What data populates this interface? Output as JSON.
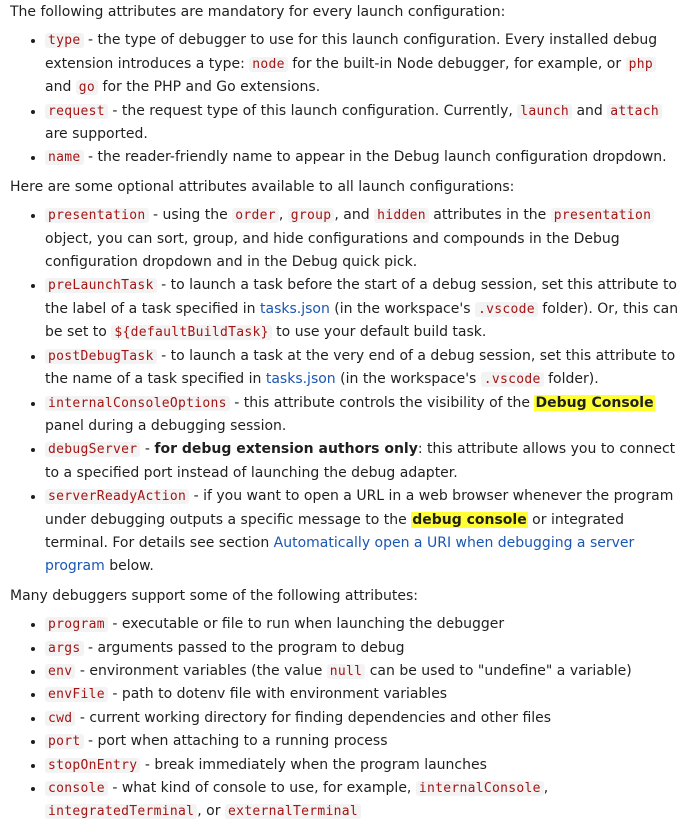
{
  "intro_mandatory": "The following attributes are mandatory for every launch configuration:",
  "mandatory": {
    "type": {
      "code": "type",
      "t1": " - the type of debugger to use for this launch configuration. Every installed debug extension introduces a type: ",
      "c1": "node",
      "t2": " for the built-in Node debugger, for example, or ",
      "c2": "php",
      "t3": " and ",
      "c3": "go",
      "t4": " for the PHP and Go extensions."
    },
    "request": {
      "code": "request",
      "t1": " - the request type of this launch configuration. Currently, ",
      "c1": "launch",
      "t2": " and ",
      "c2": "attach",
      "t3": " are supported."
    },
    "name": {
      "code": "name",
      "t1": " - the reader-friendly name to appear in the Debug launch configuration dropdown."
    }
  },
  "intro_optional": "Here are some optional attributes available to all launch configurations:",
  "optional": {
    "presentation": {
      "code": "presentation",
      "t1": " - using the ",
      "c1": "order",
      "t2": ", ",
      "c2": "group",
      "t3": ", and ",
      "c3": "hidden",
      "t4": " attributes in the ",
      "c4": "presentation",
      "t5": " object, you can sort, group, and hide configurations and compounds in the Debug configuration dropdown and in the Debug quick pick."
    },
    "preLaunchTask": {
      "code": "preLaunchTask",
      "t1": " - to launch a task before the start of a debug session, set this attribute to the label of a task specified in ",
      "link": "tasks.json",
      "t2": " (in the workspace's ",
      "c1": ".vscode",
      "t3": " folder). Or, this can be set to ",
      "c2": "${defaultBuildTask}",
      "t4": " to use your default build task."
    },
    "postDebugTask": {
      "code": "postDebugTask",
      "t1": " - to launch a task at the very end of a debug session, set this attribute to the name of a task specified in ",
      "link": "tasks.json",
      "t2": " (in the workspace's ",
      "c1": ".vscode",
      "t3": " folder)."
    },
    "internalConsoleOptions": {
      "code": "internalConsoleOptions",
      "t1": " - this attribute controls the visibility of the ",
      "mark": "Debug Console",
      "t2": " panel during a debugging session."
    },
    "debugServer": {
      "code": "debugServer",
      "t1": " - ",
      "bold": "for debug extension authors only",
      "t2": ": this attribute allows you to connect to a specified port instead of launching the debug adapter."
    },
    "serverReadyAction": {
      "code": "serverReadyAction",
      "t1": " - if you want to open a URL in a web browser whenever the program under debugging outputs a specific message to the ",
      "mark": "debug console",
      "t2": " or integrated terminal. For details see section ",
      "link": "Automatically open a URI when debugging a server program",
      "t3": " below."
    }
  },
  "intro_many": "Many debuggers support some of the following attributes:",
  "many": {
    "program": {
      "code": "program",
      "t1": " - executable or file to run when launching the debugger"
    },
    "args": {
      "code": "args",
      "t1": " - arguments passed to the program to debug"
    },
    "env": {
      "code": "env",
      "t1": " - environment variables (the value ",
      "c1": "null",
      "t2": " can be used to \"undefine\" a variable)"
    },
    "envFile": {
      "code": "envFile",
      "t1": " - path to dotenv file with environment variables"
    },
    "cwd": {
      "code": "cwd",
      "t1": " - current working directory for finding dependencies and other files"
    },
    "port": {
      "code": "port",
      "t1": " - port when attaching to a running process"
    },
    "stopOnEntry": {
      "code": "stopOnEntry",
      "t1": " - break immediately when the program launches"
    },
    "console": {
      "code": "console",
      "t1": " - what kind of console to use, for example, ",
      "c1": "internalConsole",
      "t2": ", ",
      "c2": "integratedTerminal",
      "t3": ", or ",
      "c3": "externalTerminal"
    }
  },
  "colors": {
    "code_text": "#a31515",
    "code_bg": "#f3f3f3",
    "link": "#1a56b3",
    "highlight": "#ffff33"
  }
}
